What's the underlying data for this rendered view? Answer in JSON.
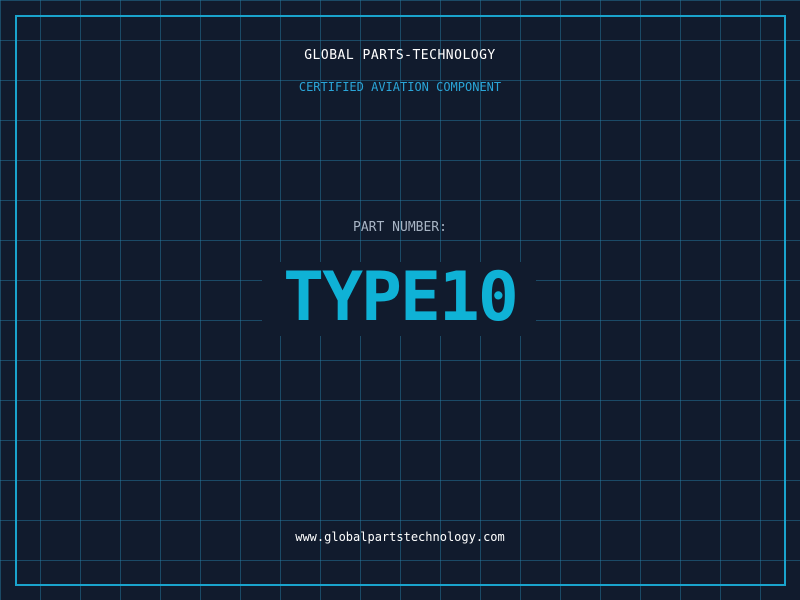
{
  "header": {
    "company": "GLOBAL PARTS-TECHNOLOGY",
    "subtitle": "CERTIFIED AVIATION COMPONENT"
  },
  "part": {
    "label": "PART NUMBER:",
    "number": "TYPE10"
  },
  "footer": {
    "website": "www.globalpartstechnology.com"
  },
  "colors": {
    "background": "#111b2d",
    "grid": "#2882aa",
    "frame": "#1aa3cc",
    "accent": "#0fb2d6",
    "subtitle": "#2aa5d8"
  }
}
